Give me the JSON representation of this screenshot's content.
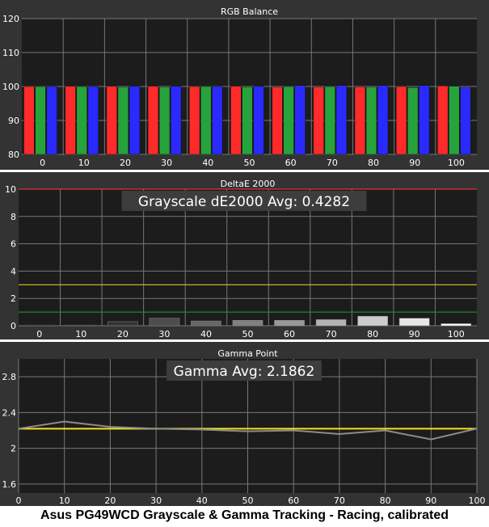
{
  "caption": "Asus PG49WCD Grayscale & Gamma Tracking - Racing, calibrated",
  "colors": {
    "panel_bg": "#333333",
    "plot_bg": "#1c1c1c",
    "gridline": "#777777",
    "text": "#ffffff",
    "red": "#ff2a2a",
    "green": "#27a33c",
    "blue": "#2a2aff",
    "reference_line": "#f2e31a",
    "delta_red_line": "#e23030",
    "delta_yellow_line": "#d6c81e",
    "delta_green_line": "#1f8a1f",
    "gamma_line": "#8c8c8c",
    "avg_box_bg": "#3d3d3d"
  },
  "chart_data": [
    {
      "type": "bar",
      "title": "RGB Balance",
      "categories": [
        "0",
        "10",
        "20",
        "30",
        "40",
        "50",
        "60",
        "70",
        "80",
        "90",
        "100"
      ],
      "series": [
        {
          "name": "Red",
          "values": [
            100.0,
            100.1,
            100.1,
            100.1,
            100.0,
            100.1,
            99.8,
            99.8,
            99.9,
            100.0,
            100.2
          ]
        },
        {
          "name": "Green",
          "values": [
            100.0,
            100.0,
            99.8,
            99.8,
            100.0,
            99.8,
            100.0,
            100.0,
            99.8,
            99.7,
            100.1
          ]
        },
        {
          "name": "Blue",
          "values": [
            100.0,
            100.0,
            100.1,
            100.1,
            100.0,
            100.1,
            100.3,
            100.3,
            100.3,
            100.3,
            99.8
          ]
        }
      ],
      "ylim": [
        80,
        120
      ],
      "yticks": [
        80,
        90,
        100,
        110,
        120
      ],
      "grid": true
    },
    {
      "type": "bar",
      "title": "DeltaE 2000",
      "annotation": "Grayscale dE2000 Avg: 0.4282",
      "categories": [
        "0",
        "10",
        "20",
        "30",
        "40",
        "50",
        "60",
        "70",
        "80",
        "90",
        "100"
      ],
      "values": [
        0.05,
        0.05,
        0.3,
        0.55,
        0.35,
        0.4,
        0.4,
        0.45,
        0.7,
        0.55,
        0.15
      ],
      "bar_colors": [
        "#000000",
        "#1a1a1a",
        "#333333",
        "#4d4d4d",
        "#666666",
        "#808080",
        "#999999",
        "#b3b3b3",
        "#cccccc",
        "#e6e6e6",
        "#ffffff"
      ],
      "reference_lines": [
        {
          "value": 10,
          "color": "#e23030"
        },
        {
          "value": 3,
          "color": "#d6c81e"
        },
        {
          "value": 1,
          "color": "#1f8a1f"
        }
      ],
      "ylim": [
        0,
        10
      ],
      "yticks": [
        0,
        2,
        4,
        6,
        8,
        10
      ],
      "grid": true
    },
    {
      "type": "line",
      "title": "Gamma Point",
      "annotation": "Gamma Avg: 2.1862",
      "x": [
        0,
        10,
        20,
        30,
        40,
        50,
        60,
        70,
        80,
        90,
        100
      ],
      "values": [
        2.22,
        2.3,
        2.24,
        2.22,
        2.21,
        2.19,
        2.2,
        2.16,
        2.2,
        2.1,
        2.22
      ],
      "reference_value": 2.22,
      "xlim": [
        0,
        100
      ],
      "xticks": [
        0,
        10,
        20,
        30,
        40,
        50,
        60,
        70,
        80,
        90,
        100
      ],
      "ylim": [
        1.5,
        3.0
      ],
      "yticks": [
        1.6,
        2,
        2.4,
        2.8
      ],
      "grid": true
    }
  ]
}
